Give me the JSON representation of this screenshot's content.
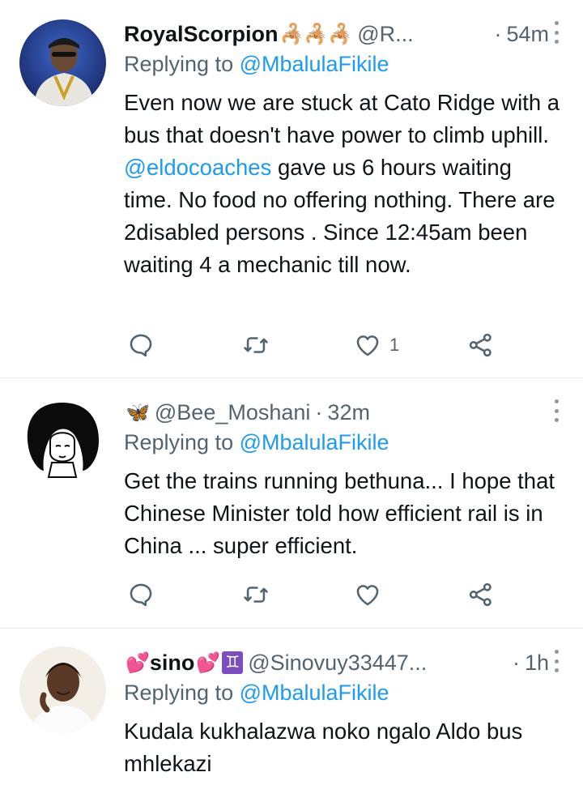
{
  "tweets": [
    {
      "name": "RoyalScorpion",
      "name_emoji": "🦂🦂🦂",
      "handle": "@R...",
      "dot": "·",
      "time": "54m",
      "replying_prefix": "Replying to ",
      "replying_to": "@MbalulaFikile",
      "text_1": "Even  now we are stuck at Cato Ridge with a  bus that doesn't have power to climb uphill. ",
      "text_link": "@eldocoaches",
      "text_2": " gave us 6 hours waiting time. No food no offering nothing. There are 2disabled persons . Since 12:45am been waiting 4 a mechanic till now.",
      "like_count": "1",
      "icons": [
        "reply-icon",
        "retweet-icon",
        "like-icon",
        "share-icon",
        "more-icon"
      ]
    },
    {
      "name_emoji": "🦋",
      "handle": "@Bee_Moshani",
      "dot": "·",
      "time": "32m",
      "replying_prefix": "Replying to ",
      "replying_to": "@MbalulaFikile",
      "text": "Get the trains running bethuna... I hope that Chinese Minister told how efficient rail is in China ... super efficient.",
      "icons": [
        "reply-icon",
        "retweet-icon",
        "like-icon",
        "share-icon",
        "more-icon"
      ]
    },
    {
      "name_emoji_pre": "💕",
      "name": "sino",
      "name_emoji_post": "💕",
      "name_sign": "♊",
      "handle": "@Sinovuy33447...",
      "dot": "·",
      "time": "1h",
      "replying_prefix": "Replying to ",
      "replying_to": "@MbalulaFikile",
      "text": "Kudala kukhalazwa noko ngalo Aldo bus mhlekazi"
    }
  ],
  "colors": {
    "link": "#1d9bf0",
    "muted": "#536471",
    "text": "#0f1419",
    "divider": "#e6ecf0"
  }
}
